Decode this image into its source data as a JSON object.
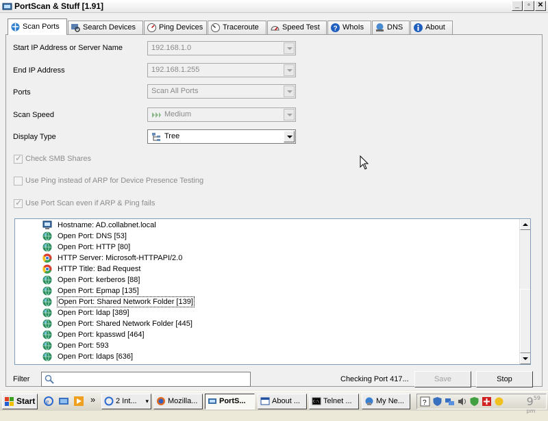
{
  "window": {
    "title": "PortScan & Stuff [1.91]",
    "minimize": "_",
    "maximize": "▫",
    "close": "✕"
  },
  "tabs": [
    {
      "label": "Scan Ports",
      "icon": "network-icon",
      "active": true
    },
    {
      "label": "Search Devices",
      "icon": "search-icon"
    },
    {
      "label": "Ping Devices",
      "icon": "ping-icon"
    },
    {
      "label": "Traceroute",
      "icon": "trace-icon"
    },
    {
      "label": "Speed Test",
      "icon": "speedometer-icon"
    },
    {
      "label": "WhoIs",
      "icon": "question-icon"
    },
    {
      "label": "DNS",
      "icon": "dns-icon"
    },
    {
      "label": "About",
      "icon": "info-icon"
    }
  ],
  "form": {
    "start_ip_label": "Start IP Address or Server Name",
    "start_ip_value": "192.168.1.0",
    "end_ip_label": "End IP Address",
    "end_ip_value": "192.168.1.255",
    "ports_label": "Ports",
    "ports_value": "Scan All Ports",
    "scan_speed_label": "Scan Speed",
    "scan_speed_value": "Medium",
    "display_type_label": "Display Type",
    "display_type_value": "Tree"
  },
  "checkboxes": [
    {
      "label": "Check SMB Shares",
      "checked": true
    },
    {
      "label": "Use Ping instead of ARP for Device Presence Testing",
      "checked": false
    },
    {
      "label": "Use Port Scan even if ARP & Ping fails",
      "checked": true
    }
  ],
  "results": [
    {
      "text": "Hostname: AD.collabnet.local",
      "icon": "computer-icon"
    },
    {
      "text": "Open Port: DNS [53]",
      "icon": "globe-icon"
    },
    {
      "text": "Open Port: HTTP [80]",
      "icon": "globe-icon"
    },
    {
      "text": "HTTP Server: Microsoft-HTTPAPI/2.0",
      "icon": "chrome-icon"
    },
    {
      "text": "HTTP Title: Bad Request",
      "icon": "chrome-icon"
    },
    {
      "text": "Open Port: kerberos [88]",
      "icon": "globe-icon"
    },
    {
      "text": "Open Port: Epmap [135]",
      "icon": "globe-icon"
    },
    {
      "text": "Open Port: Shared Network Folder [139]",
      "icon": "globe-icon",
      "selected": true
    },
    {
      "text": "Open Port: ldap [389]",
      "icon": "globe-icon"
    },
    {
      "text": "Open Port: Shared Network Folder [445]",
      "icon": "globe-icon"
    },
    {
      "text": "Open Port: kpasswd [464]",
      "icon": "globe-icon"
    },
    {
      "text": "Open Port: 593",
      "icon": "globe-icon"
    },
    {
      "text": "Open Port: ldaps [636]",
      "icon": "globe-icon"
    }
  ],
  "bottom": {
    "filter_label": "Filter",
    "filter_value": "",
    "status": "Checking Port 417...",
    "save_label": "Save",
    "stop_label": "Stop"
  },
  "taskbar": {
    "start_label": "Start",
    "quicklaunch_more": "»",
    "items": [
      {
        "label": "2 Int...",
        "icon": "ie-icon",
        "dropdown": true
      },
      {
        "label": "Mozilla...",
        "icon": "firefox-icon"
      },
      {
        "label": "PortS...",
        "icon": "portscan-icon",
        "active": true
      },
      {
        "label": "About ...",
        "icon": "window-icon"
      },
      {
        "label": "Telnet ...",
        "icon": "console-icon"
      },
      {
        "label": "My Ne...",
        "icon": "network-places-icon"
      }
    ],
    "clock_hour": "9",
    "clock_min": "59",
    "clock_ampm": "pm"
  }
}
